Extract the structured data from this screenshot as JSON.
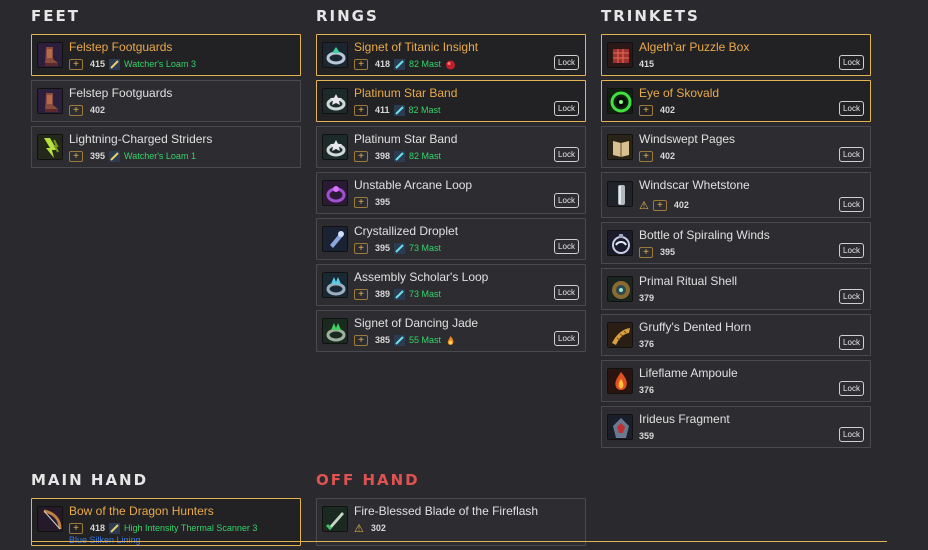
{
  "lock_label": "Lock",
  "feet": {
    "title": "FEET",
    "items": [
      {
        "name": "Felstep Footguards",
        "ilvl": "415",
        "extra": "Watcher's Loam 3"
      },
      {
        "name": "Felstep Footguards",
        "ilvl": "402"
      },
      {
        "name": "Lightning-Charged Striders",
        "ilvl": "395",
        "extra": "Watcher's Loam 1"
      }
    ]
  },
  "rings": {
    "title": "RINGS",
    "items": [
      {
        "name": "Signet of Titanic Insight",
        "ilvl": "418",
        "extra": "82 Mast"
      },
      {
        "name": "Platinum Star Band",
        "ilvl": "411",
        "extra": "82 Mast"
      },
      {
        "name": "Platinum Star Band",
        "ilvl": "398",
        "extra": "82 Mast"
      },
      {
        "name": "Unstable Arcane Loop",
        "ilvl": "395"
      },
      {
        "name": "Crystallized Droplet",
        "ilvl": "395",
        "extra": "73 Mast"
      },
      {
        "name": "Assembly Scholar's Loop",
        "ilvl": "389",
        "extra": "73 Mast"
      },
      {
        "name": "Signet of Dancing Jade",
        "ilvl": "385",
        "extra": "55 Mast"
      }
    ]
  },
  "trinkets": {
    "title": "TRINKETS",
    "items": [
      {
        "name": "Algeth'ar Puzzle Box",
        "ilvl": "415"
      },
      {
        "name": "Eye of Skovald",
        "ilvl": "402"
      },
      {
        "name": "Windswept Pages",
        "ilvl": "402"
      },
      {
        "name": "Windscar Whetstone",
        "ilvl": "402"
      },
      {
        "name": "Bottle of Spiraling Winds",
        "ilvl": "395"
      },
      {
        "name": "Primal Ritual Shell",
        "ilvl": "379"
      },
      {
        "name": "Gruffy's Dented Horn",
        "ilvl": "376"
      },
      {
        "name": "Lifeflame Ampoule",
        "ilvl": "376"
      },
      {
        "name": "Irideus Fragment",
        "ilvl": "359"
      }
    ]
  },
  "main_hand": {
    "title": "MAIN HAND",
    "items": [
      {
        "name": "Bow of the Dragon Hunters",
        "ilvl": "418",
        "extra": "High Intensity Thermal Scanner 3",
        "extra2": "Blue Silken Lining"
      }
    ]
  },
  "off_hand": {
    "title": "OFF HAND",
    "items": [
      {
        "name": "Fire-Blessed Blade of the Fireflash",
        "ilvl": "302"
      }
    ]
  },
  "colors": {
    "selected_border": "#e2b450",
    "green_text": "#34d26a",
    "off_hand_title": "#e05252"
  }
}
